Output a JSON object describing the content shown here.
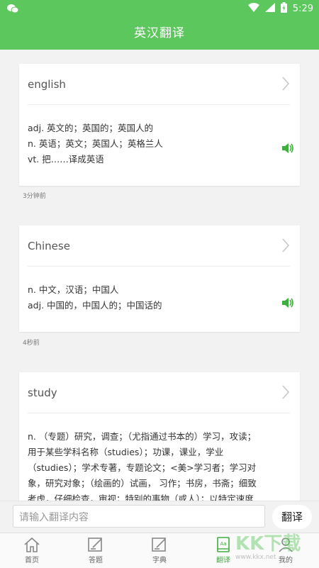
{
  "status_bar": {
    "time": "5:29"
  },
  "header": {
    "title": "英汉翻译"
  },
  "history": [
    {
      "word": "english",
      "definitions": [
        "adj. 英文的；英国的；英国人的",
        "n. 英语；英文；英国人；英格兰人",
        "vt. 把……译成英语"
      ],
      "time": "3分钟前"
    },
    {
      "word": "Chinese",
      "definitions": [
        "n. 中文，汉语；中国人",
        "adj. 中国的，中国人的；中国话的"
      ],
      "time": "4秒前"
    },
    {
      "word": "study",
      "definitions": [
        "n. （专题）研究，调查；（尤指通过书本的）学习，攻读；",
        "用于某些学科名称（studies）；功课，课业，学业",
        "（studies）；学术专著，专题论文；<美>学习者；学习对",
        "象，研究对象；（绘画的）试画， 习作；书房，书斋；细致",
        "考虑，仔细检查，审视；特别的事物（或人）；以特定速度"
      ]
    }
  ],
  "input": {
    "placeholder": "请输入翻译内容"
  },
  "translate_button": "翻译",
  "tabs": [
    {
      "label": "首页",
      "icon": "home-icon"
    },
    {
      "label": "答题",
      "icon": "edit-icon"
    },
    {
      "label": "字典",
      "icon": "edit-icon"
    },
    {
      "label": "翻译",
      "icon": "book-icon"
    },
    {
      "label": "我的",
      "icon": "person-icon"
    }
  ],
  "watermark": {
    "text": "KK下载",
    "url": "www.kkx.net"
  },
  "colors": {
    "accent": "#5cc75c",
    "active_tab": "#3fae3f"
  }
}
